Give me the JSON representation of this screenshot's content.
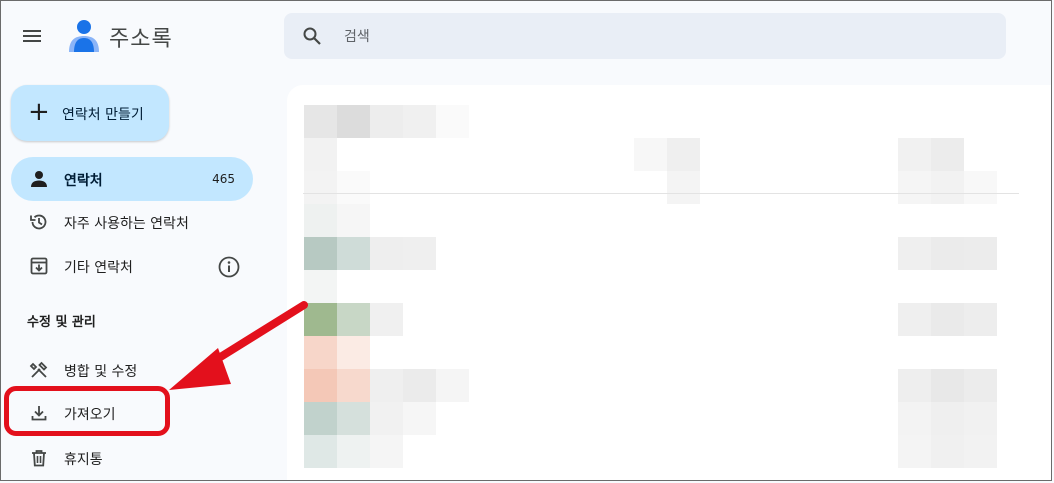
{
  "header": {
    "app_title": "주소록",
    "menu_icon": "hamburger-menu-icon",
    "logo_icon": "contacts-person-logo-icon"
  },
  "search": {
    "placeholder": "검색",
    "value": "",
    "icon": "search-icon"
  },
  "create_button": {
    "label": "연락처 만들기",
    "icon": "plus-icon"
  },
  "sidebar": {
    "items": [
      {
        "label": "연락처",
        "count": "465",
        "icon": "person-icon",
        "active": true
      },
      {
        "label": "자주 사용하는 연락처",
        "icon": "history-icon"
      },
      {
        "label": "기타 연락처",
        "icon": "archive-download-icon",
        "extra_icon": "info-icon"
      }
    ],
    "section_title": "수정 및 관리",
    "manage_items": [
      {
        "label": "병합 및 수정",
        "icon": "tools-icon"
      },
      {
        "label": "가져오기",
        "icon": "import-download-icon"
      },
      {
        "label": "휴지통",
        "icon": "trash-icon"
      }
    ]
  },
  "annotation": {
    "color": "#e3101c",
    "highlighted_item": "가져오기"
  },
  "colors": {
    "accent": "#c2e7ff",
    "background": "#f8fafd",
    "search_bg": "#e9eef6"
  }
}
